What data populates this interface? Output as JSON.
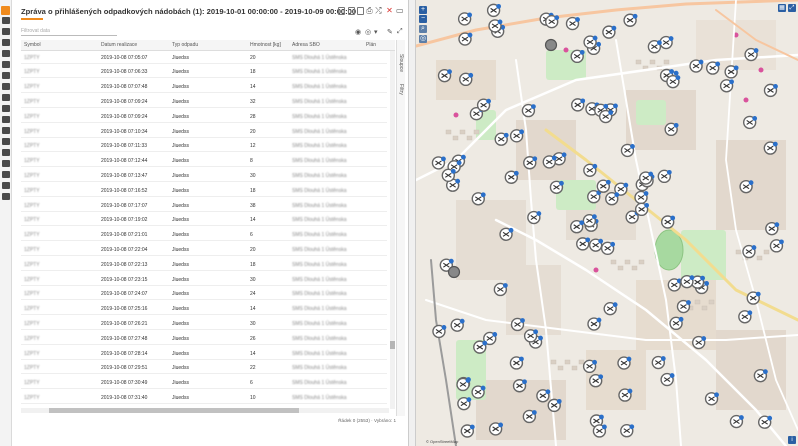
{
  "report": {
    "title": "Zpráva o přihlášených odpadkových nádobách (1): 2019-10-01 00:00:00 - 2019-10-09 00:00:00",
    "filter_placeholder": "Filtrovat data",
    "columns": [
      "Symbol",
      "Datum realizace",
      "Typ odpadu",
      "Hmotnost [kg]",
      "Adresa SBO",
      "Plán"
    ],
    "rows": [
      {
        "symbol": "1ZPTY",
        "date": "2019-10-08 07:05:07",
        "type": "Jiuedss",
        "weight": "20",
        "address": "SMS Dlouhá 1 Ústěnska"
      },
      {
        "symbol": "1ZPTY",
        "date": "2019-10-08 07:06:33",
        "type": "Jiuedss",
        "weight": "18",
        "address": "SMS Dlouhá 1 Ústěnska"
      },
      {
        "symbol": "1ZPTY",
        "date": "2019-10-08 07:07:48",
        "type": "Jiuedss",
        "weight": "14",
        "address": "SMS Dlouhá 1 Ústěnska"
      },
      {
        "symbol": "1ZPTY",
        "date": "2019-10-08 07:09:24",
        "type": "Jiuedss",
        "weight": "32",
        "address": "SMS Dlouhá 1 Ústěnska"
      },
      {
        "symbol": "1ZPTY",
        "date": "2019-10-08 07:09:24",
        "type": "Jiuedss",
        "weight": "28",
        "address": "SMS Dlouhá 1 Ústěnska"
      },
      {
        "symbol": "1ZPTY",
        "date": "2019-10-08 07:10:34",
        "type": "Jiuedss",
        "weight": "20",
        "address": "SMS Dlouhá 1 Ústěnska"
      },
      {
        "symbol": "1ZPTY",
        "date": "2019-10-08 07:11:33",
        "type": "Jiuedss",
        "weight": "12",
        "address": "SMS Dlouhá 1 Ústěnska"
      },
      {
        "symbol": "1ZPTY",
        "date": "2019-10-08 07:12:44",
        "type": "Jiuedss",
        "weight": "8",
        "address": "SMS Dlouhá 1 Ústěnska"
      },
      {
        "symbol": "1ZPTY",
        "date": "2019-10-08 07:13:47",
        "type": "Jiuedss",
        "weight": "30",
        "address": "SMS Dlouhá 1 Ústěnska"
      },
      {
        "symbol": "1ZPTY",
        "date": "2019-10-08 07:16:52",
        "type": "Jiuedss",
        "weight": "18",
        "address": "SMS Dlouhá 1 Ústěnska"
      },
      {
        "symbol": "1ZPTY",
        "date": "2019-10-08 07:17:07",
        "type": "Jiuedss",
        "weight": "38",
        "address": "SMS Dlouhá 1 Ústěnska"
      },
      {
        "symbol": "1ZPTY",
        "date": "2019-10-08 07:19:02",
        "type": "Jiuedss",
        "weight": "14",
        "address": "SMS Dlouhá 1 Ústěnska"
      },
      {
        "symbol": "1ZPTY",
        "date": "2019-10-08 07:21:01",
        "type": "Jiuedss",
        "weight": "6",
        "address": "SMS Dlouhá 1 Ústěnska"
      },
      {
        "symbol": "1ZPTY",
        "date": "2019-10-08 07:22:04",
        "type": "Jiuedss",
        "weight": "20",
        "address": "SMS Dlouhá 1 Ústěnska"
      },
      {
        "symbol": "1ZPTY",
        "date": "2019-10-08 07:22:13",
        "type": "Jiuedss",
        "weight": "18",
        "address": "SMS Dlouhá 1 Ústěnska"
      },
      {
        "symbol": "1ZPTY",
        "date": "2019-10-08 07:23:15",
        "type": "Jiuedss",
        "weight": "30",
        "address": "SMS Dlouhá 1 Ústěnska"
      },
      {
        "symbol": "1ZPTY",
        "date": "2019-10-08 07:24:07",
        "type": "Jiuedss",
        "weight": "24",
        "address": "SMS Dlouhá 1 Ústěnska"
      },
      {
        "symbol": "1ZPTY",
        "date": "2019-10-08 07:25:16",
        "type": "Jiuedss",
        "weight": "14",
        "address": "SMS Dlouhá 1 Ústěnska"
      },
      {
        "symbol": "1ZPTY",
        "date": "2019-10-08 07:26:21",
        "type": "Jiuedss",
        "weight": "30",
        "address": "SMS Dlouhá 1 Ústěnska"
      },
      {
        "symbol": "1ZPTY",
        "date": "2019-10-08 07:27:48",
        "type": "Jiuedss",
        "weight": "26",
        "address": "SMS Dlouhá 1 Ústěnska"
      },
      {
        "symbol": "1ZPTY",
        "date": "2019-10-08 07:28:14",
        "type": "Jiuedss",
        "weight": "14",
        "address": "SMS Dlouhá 1 Ústěnska"
      },
      {
        "symbol": "1ZPTY",
        "date": "2019-10-08 07:29:51",
        "type": "Jiuedss",
        "weight": "22",
        "address": "SMS Dlouhá 1 Ústěnska"
      },
      {
        "symbol": "1ZPTY",
        "date": "2019-10-08 07:30:49",
        "type": "Jiuedss",
        "weight": "6",
        "address": "SMS Dlouhá 1 Ústěnska"
      },
      {
        "symbol": "1ZPTY",
        "date": "2019-10-08 07:31:40",
        "type": "Jiuedss",
        "weight": "10",
        "address": "SMS Dlouhá 1 Ústěnska"
      }
    ],
    "side_tabs": [
      "Sloupce",
      "Filtry"
    ],
    "footer": "Řádek 0 (2553) · Vybráno: 1"
  },
  "map": {
    "zoom_in": "+",
    "zoom_out": "−",
    "info_label": "i",
    "layer_label": "▦",
    "attribution": "© OpenStreetMap",
    "accent_color": "#2a5fa3",
    "brand_color": "#f08a1c"
  },
  "icons": {
    "sidebar": [
      "logo-icon",
      "home-icon",
      "info-icon",
      "chart-icon",
      "users-icon",
      "bin-icon",
      "calendar-icon",
      "truck-icon",
      "tool-icon",
      "list-icon",
      "layers-icon",
      "star-icon",
      "chat-icon",
      "report-icon",
      "gear-icon",
      "key-icon",
      "user-icon",
      "globe-icon"
    ],
    "toolbar": [
      "pdf-icon",
      "xls-icon",
      "csv-icon",
      "print-icon",
      "shuffle-icon",
      "close-icon",
      "window-icon"
    ],
    "view": [
      "eye-icon",
      "eye-off-icon",
      "filter-icon",
      "edit-icon",
      "expand-icon"
    ]
  }
}
